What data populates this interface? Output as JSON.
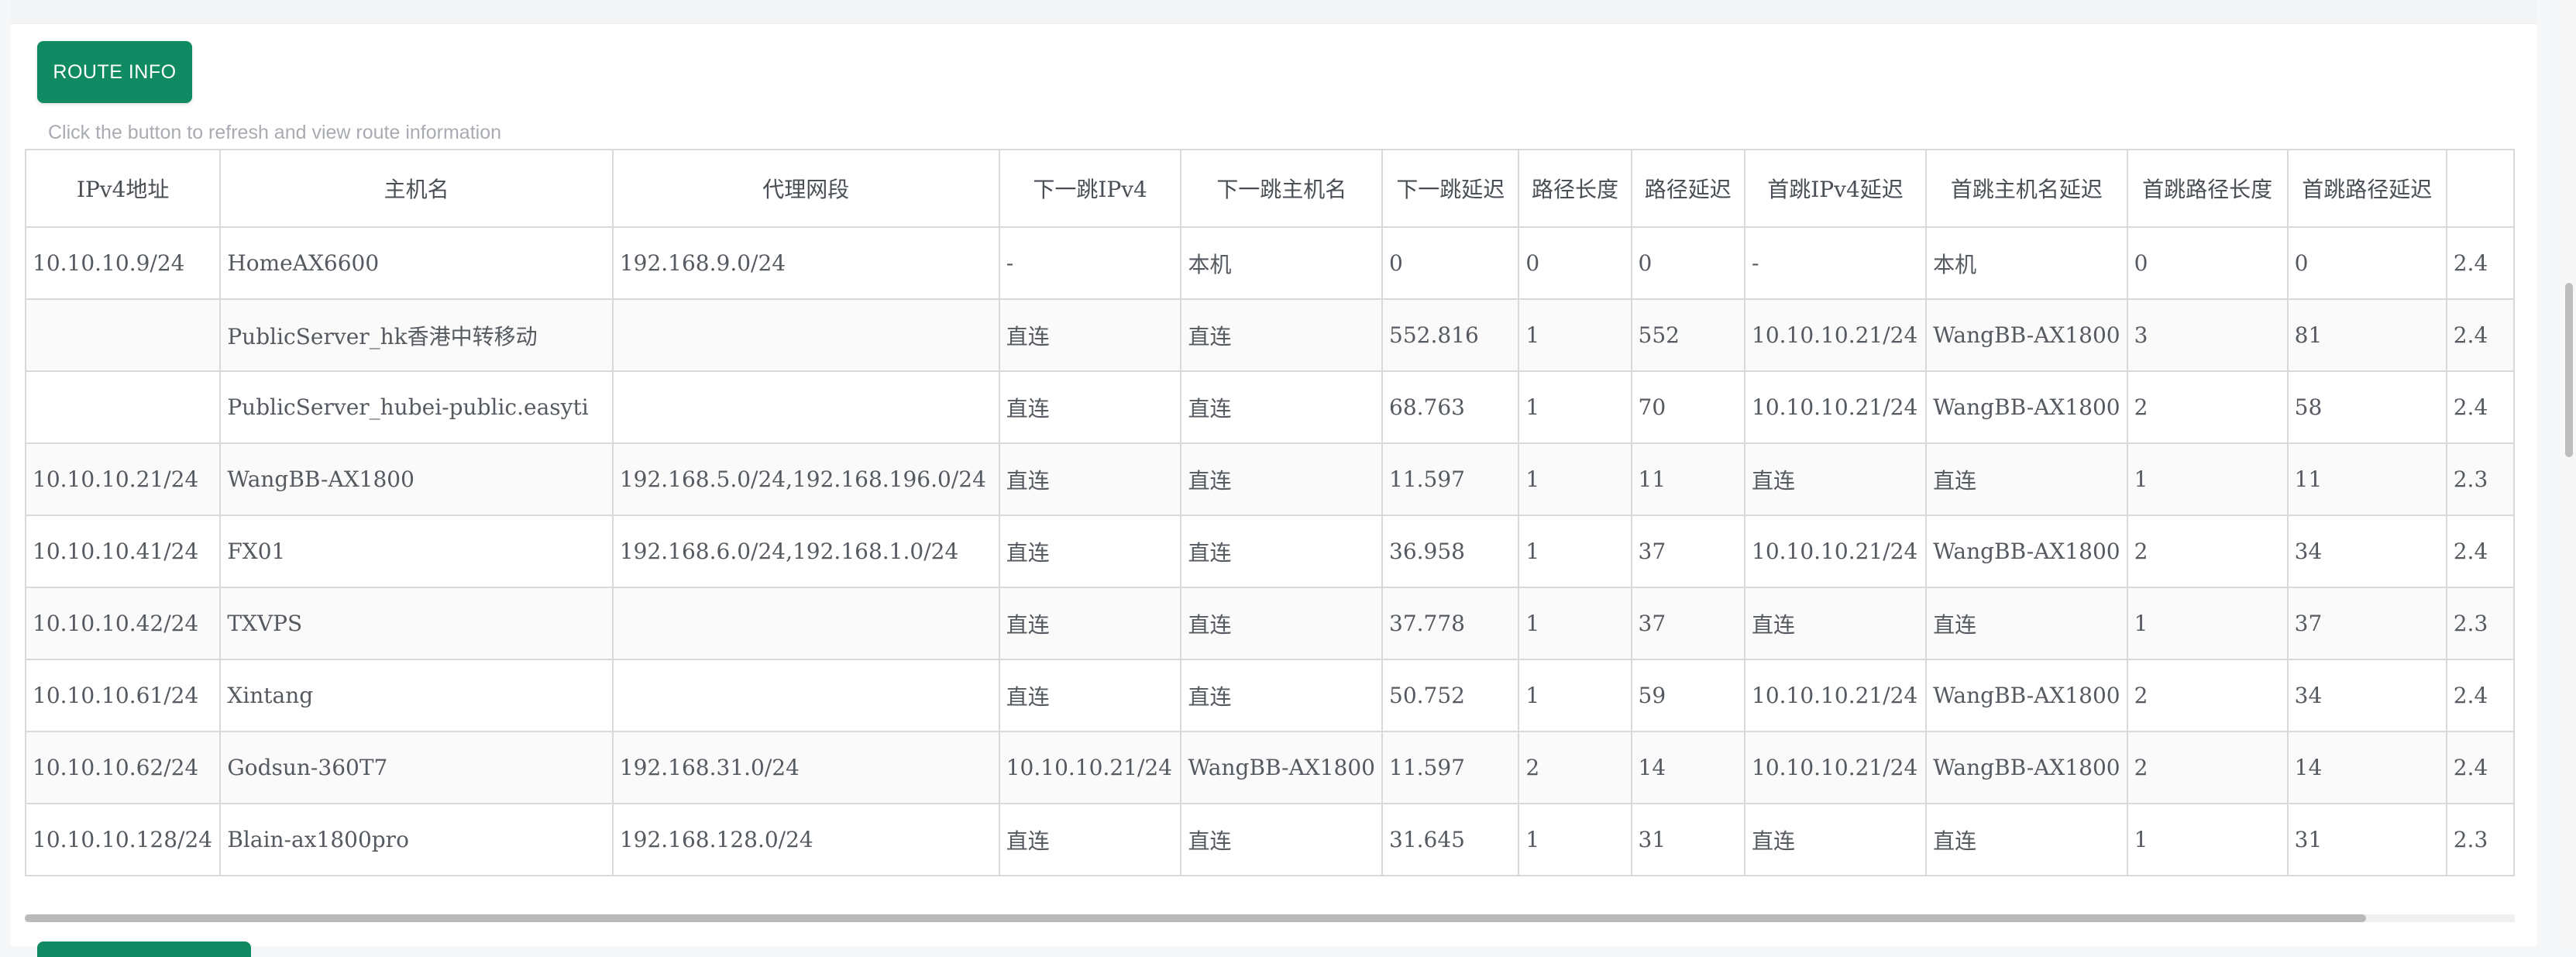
{
  "header": {
    "route_button_label": "ROUTE INFO",
    "hint": "Click the button to refresh and view route information"
  },
  "colors": {
    "accent": "#0f8a62",
    "hint_text": "#a8acb2",
    "border": "#d9d9d9"
  },
  "table": {
    "columns": [
      "IPv4地址",
      "主机名",
      "代理网段",
      "下一跳IPv4",
      "下一跳主机名",
      "下一跳延迟",
      "路径长度",
      "路径延迟",
      "首跳IPv4延迟",
      "首跳主机名延迟",
      "首跳路径长度",
      "首跳路径延迟",
      ""
    ],
    "rows": [
      [
        "10.10.10.9/24",
        "HomeAX6600",
        "192.168.9.0/24",
        "-",
        "本机",
        "0",
        "0",
        "0",
        "-",
        "本机",
        "0",
        "0",
        "2.4"
      ],
      [
        "",
        "PublicServer_hk香港中转移动",
        "",
        "直连",
        "直连",
        "552.816",
        "1",
        "552",
        "10.10.10.21/24",
        "WangBB-AX1800",
        "3",
        "81",
        "2.4"
      ],
      [
        "",
        "PublicServer_hubei-public.easyti",
        "",
        "直连",
        "直连",
        "68.763",
        "1",
        "70",
        "10.10.10.21/24",
        "WangBB-AX1800",
        "2",
        "58",
        "2.4"
      ],
      [
        "10.10.10.21/24",
        "WangBB-AX1800",
        "192.168.5.0/24,192.168.196.0/24",
        "直连",
        "直连",
        "11.597",
        "1",
        "11",
        "直连",
        "直连",
        "1",
        "11",
        "2.3"
      ],
      [
        "10.10.10.41/24",
        "FX01",
        "192.168.6.0/24,192.168.1.0/24",
        "直连",
        "直连",
        "36.958",
        "1",
        "37",
        "10.10.10.21/24",
        "WangBB-AX1800",
        "2",
        "34",
        "2.4"
      ],
      [
        "10.10.10.42/24",
        "TXVPS",
        "",
        "直连",
        "直连",
        "37.778",
        "1",
        "37",
        "直连",
        "直连",
        "1",
        "37",
        "2.3"
      ],
      [
        "10.10.10.61/24",
        "Xintang",
        "",
        "直连",
        "直连",
        "50.752",
        "1",
        "59",
        "10.10.10.21/24",
        "WangBB-AX1800",
        "2",
        "34",
        "2.4"
      ],
      [
        "10.10.10.62/24",
        "Godsun-360T7",
        "192.168.31.0/24",
        "10.10.10.21/24",
        "WangBB-AX1800",
        "11.597",
        "2",
        "14",
        "10.10.10.21/24",
        "WangBB-AX1800",
        "2",
        "14",
        "2.4"
      ],
      [
        "10.10.10.128/24",
        "Blain-ax1800pro",
        "192.168.128.0/24",
        "直连",
        "直连",
        "31.645",
        "1",
        "31",
        "直连",
        "直连",
        "1",
        "31",
        "2.3"
      ]
    ]
  }
}
